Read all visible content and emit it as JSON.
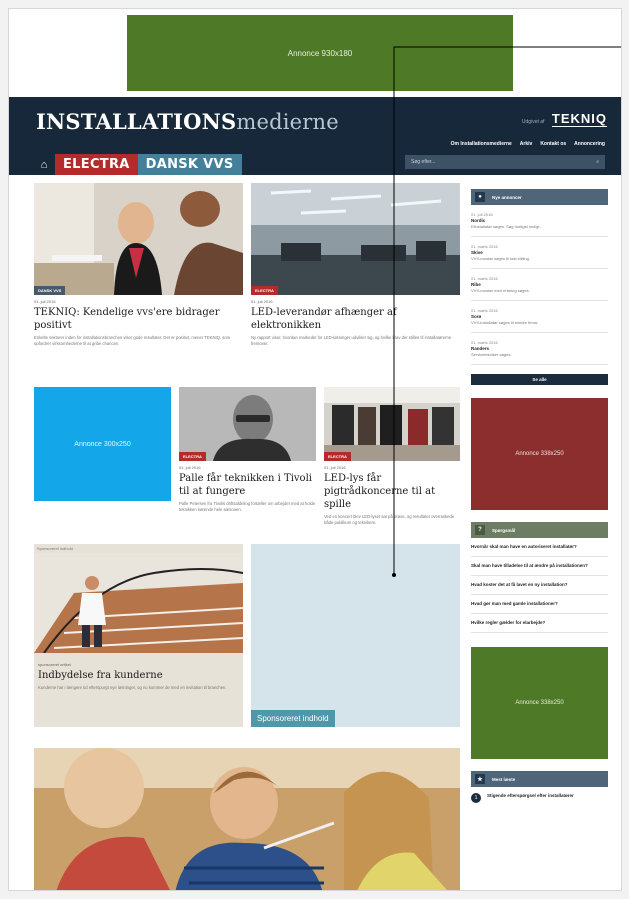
{
  "ads": {
    "top": "Annonce 930x180",
    "blue": "Annonce 300x250",
    "red": "Annonce 338x250",
    "green": "Annonce 338x250"
  },
  "header": {
    "brand_bold": "INSTALLATIONS",
    "brand_light": "medierne",
    "tekniq_pre": "Udgivet af",
    "tekniq_logo": "TEKNIQ",
    "nav": [
      "Om Installationsmedierne",
      "Arkiv",
      "Kontakt os",
      "Annoncering"
    ],
    "tabs": [
      "ELECTRA",
      "DANSK VVS"
    ],
    "search_placeholder": "Søg efter..."
  },
  "articles": [
    {
      "tag": "DANSK VVS",
      "date": "01. juli 2016",
      "title": "TEKNIQ: Kendelige vvs'ere bidrager positivt",
      "teaser": "Enkelte sektorer inden for installationsbranchen viser gode resultater. Det er positivt, mener TEKNIQ, som opfordrer virksomhederne til at gribe chancen."
    },
    {
      "tag": "ELECTRA",
      "date": "01. juli 2016",
      "title": "LED-leverandør afhænger af elektronikken",
      "teaser": "Ny rapport viser, hvordan markedet for LED-løsninger udvikler sig, og hvilke krav der stilles til installatørerne fremover."
    },
    {
      "tag": "ELECTRA",
      "date": "01. juli 2016",
      "title": "Palle får teknikken i Tivoli til at fungere",
      "teaser": "Palle Petersen fra Tivolis driftsafdeling fortæller om arbejdet med at holde teknikken kørende hele sæsonen."
    },
    {
      "tag": "ELECTRA",
      "date": "01. juli 2016",
      "title": "LED-lys får pigtrådkoncerne til at spille",
      "teaser": "Ved en koncert blev LED-lyset sat på prøve, og resultatet overraskede både publikum og teknikere."
    }
  ],
  "sponsored": {
    "pre": "Sponsoreret indhold",
    "date": "sponsoreret artikel",
    "title": "Indbydelse fra kunderne",
    "teaser": "Kunderne har i længere tid efterspurgt nye løsninger, og nu kommer de med en invitation til branchen.",
    "label": "Sponsoreret indhold"
  },
  "sidebar": {
    "jobs_title": "Nye annoncer",
    "jobs": [
      {
        "date": "01. juli 2016",
        "where": "Nordic",
        "text": "Elinstallatør søges. Søg hurtigst muligt."
      },
      {
        "date": "01. marts 2016",
        "where": "Skive",
        "text": "VVS-montør søges til fast stilling."
      },
      {
        "date": "01. marts 2016",
        "where": "Ribe",
        "text": "VVS-montør med erfaring søges."
      },
      {
        "date": "01. marts 2016",
        "where": "Sorø",
        "text": "VVS-installatør søges til mindre firma."
      },
      {
        "date": "01. marts 2016",
        "where": "Randers",
        "text": "Servicetekniker søges."
      }
    ],
    "jobs_more": "Se alle",
    "qa_title": "Spørgsmål",
    "questions": [
      "Hvornår skal man have en autoriseret installatør?",
      "Skal man have tilladelse til at ændre på installationen?",
      "Hvad koster det at få lavet en ny installation?",
      "Hvad gør man med gamle installationer?",
      "Hvilke regler gælder for elarbejde?"
    ],
    "read_title": "Mest læste",
    "read_items": [
      {
        "num": "1",
        "title": "Stigende efterspørgsel efter installatører"
      }
    ]
  }
}
